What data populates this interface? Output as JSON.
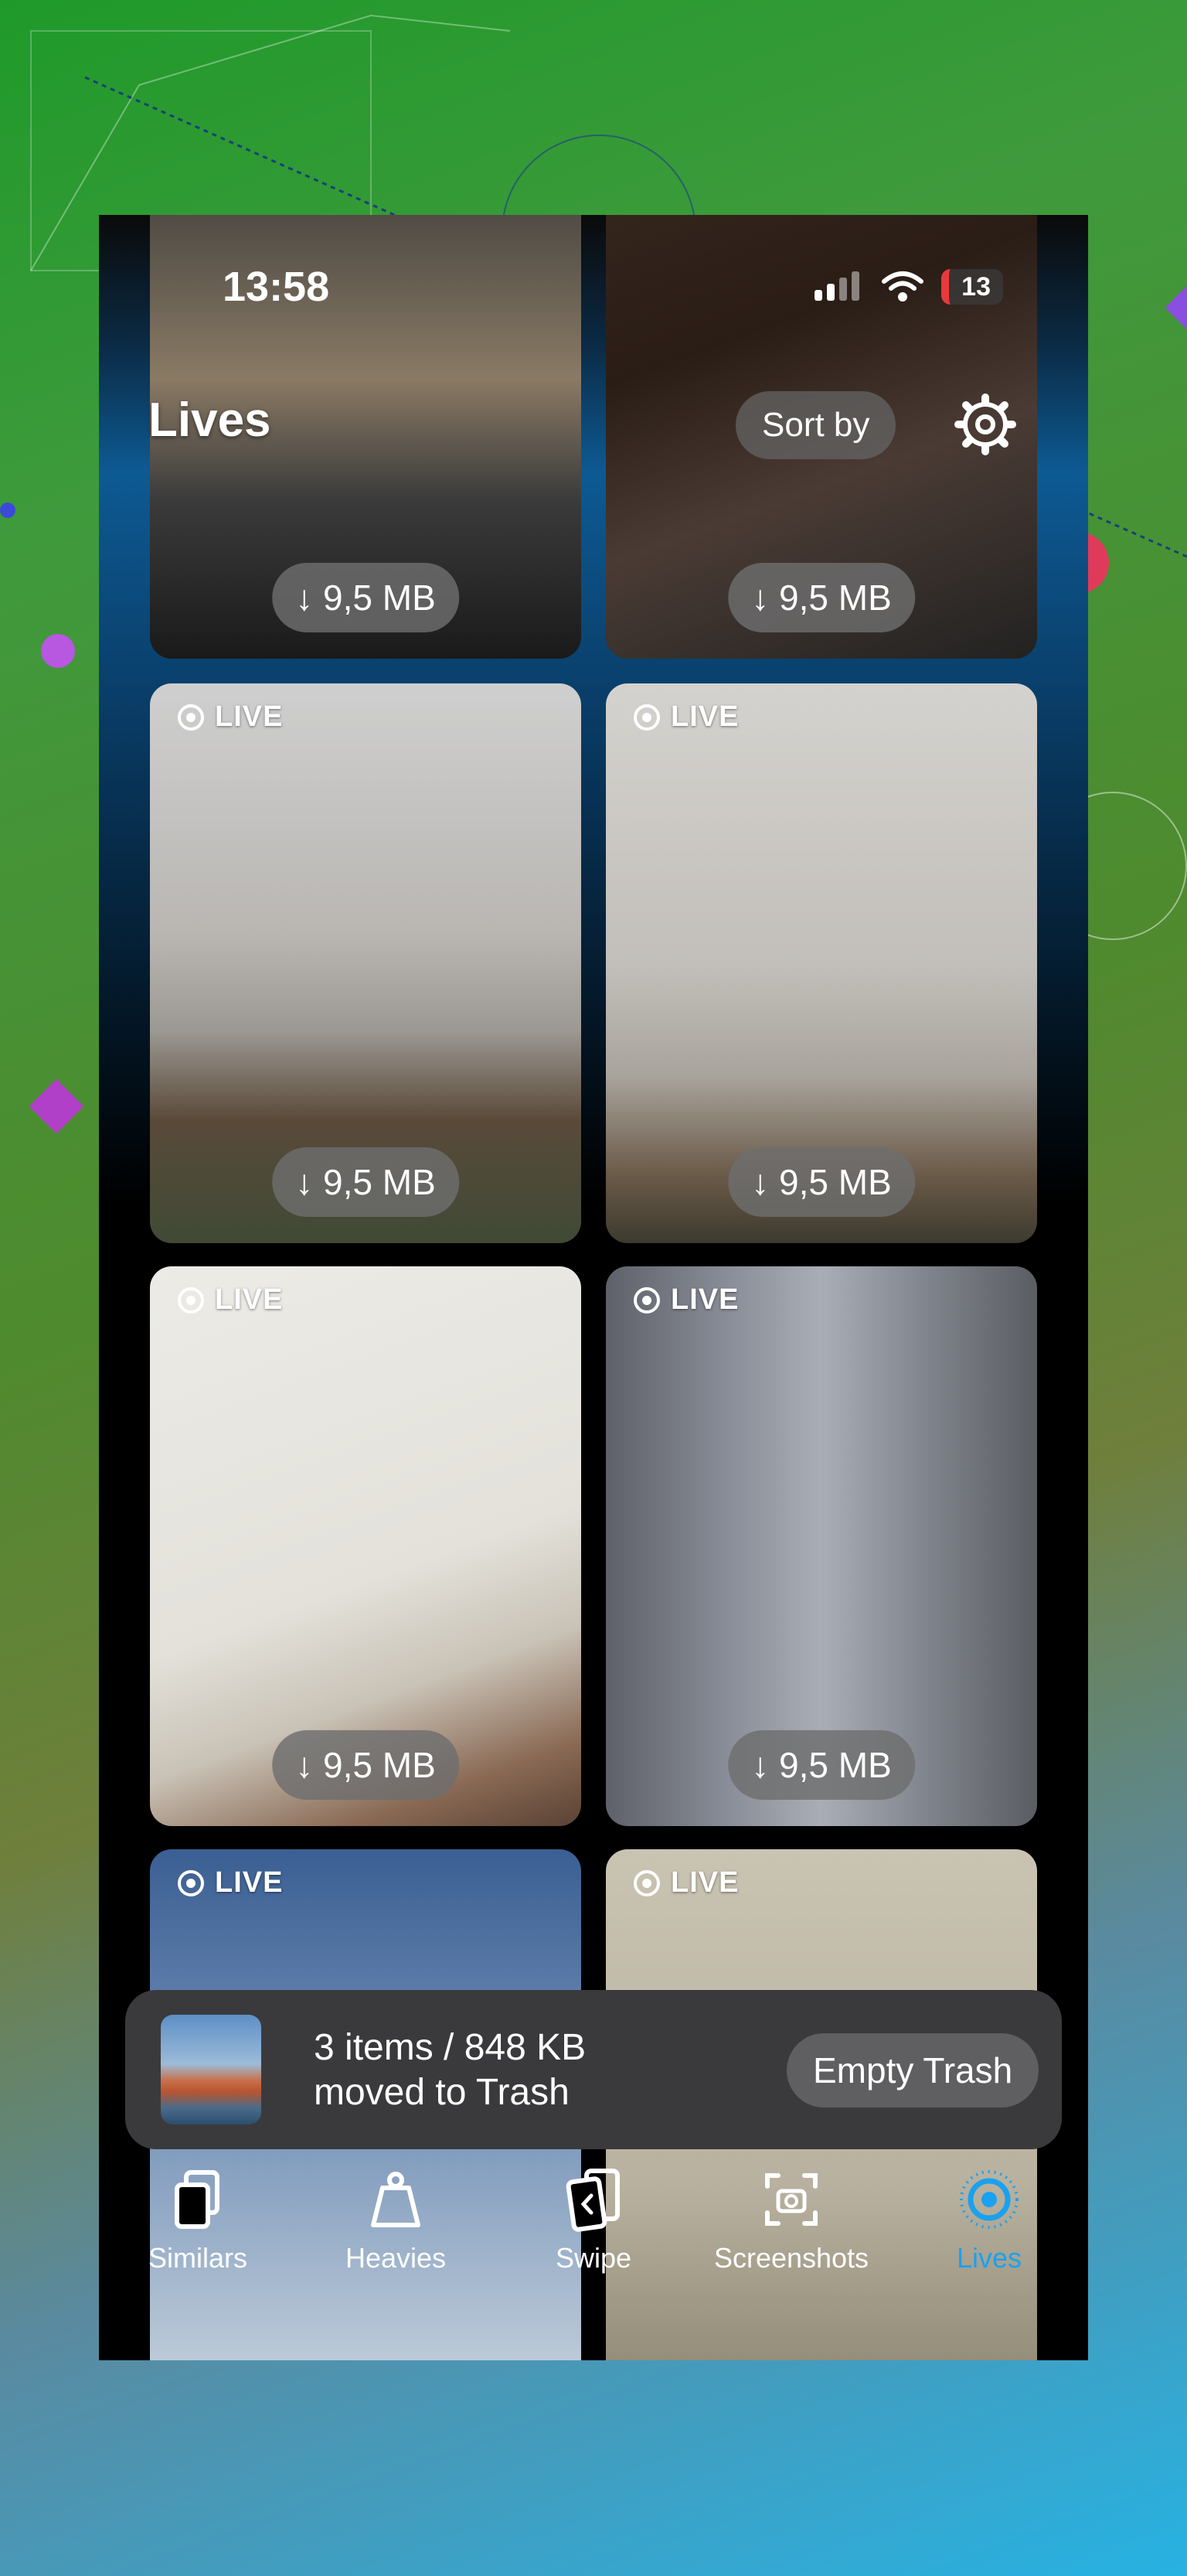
{
  "status_bar": {
    "time": "13:58",
    "battery": "13"
  },
  "header": {
    "title": "Lives",
    "sort_label": "Sort by"
  },
  "tiles": [
    {
      "size": "↓ 9,5 MB",
      "live": ""
    },
    {
      "size": "↓ 9,5 MB",
      "live": ""
    },
    {
      "size": "↓ 9,5 MB",
      "live": "LIVE"
    },
    {
      "size": "↓ 9,5 MB",
      "live": "LIVE"
    },
    {
      "size": "↓ 9,5 MB",
      "live": "LIVE"
    },
    {
      "size": "↓ 9,5 MB",
      "live": "LIVE"
    },
    {
      "size": "",
      "live": "LIVE"
    },
    {
      "size": "",
      "live": "LIVE"
    }
  ],
  "toast": {
    "line1": "3 items / 848 KB",
    "line2": "moved to Trash",
    "button": "Empty Trash"
  },
  "tabs": [
    {
      "label": "Similars",
      "icon": "copy-icon"
    },
    {
      "label": "Heavies",
      "icon": "weight-icon"
    },
    {
      "label": "Swipe",
      "icon": "swipe-cards-icon"
    },
    {
      "label": "Screenshots",
      "icon": "screenshot-camera-icon"
    },
    {
      "label": "Lives",
      "icon": "live-photo-icon",
      "active": true
    }
  ],
  "colors": {
    "accent": "#1aa1f0",
    "toast_bg": "#3a3a3c",
    "battery_low": "#e83a3a"
  }
}
